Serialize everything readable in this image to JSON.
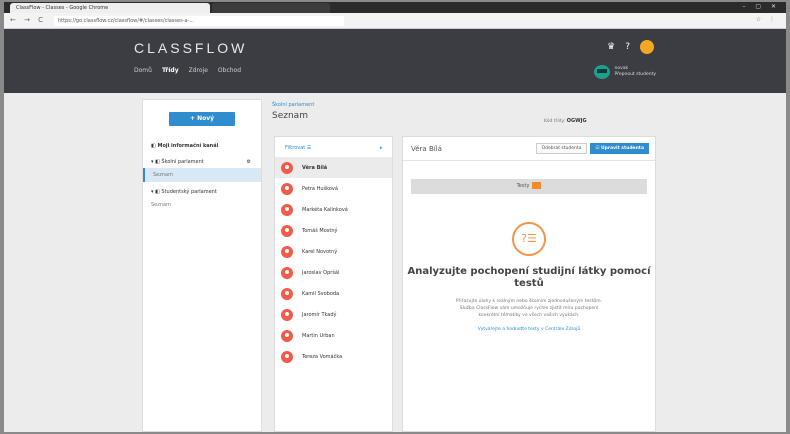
{
  "browser": {
    "tab_title": "ClassFlow - Classes - Google Chrome",
    "url": "https://go.classflow.cz/classflow/#/classes/classes-a-...",
    "nav_icons": "← → C",
    "ext_icons": "☆ ⋮"
  },
  "app": {
    "logo": "CLASSFLOW",
    "nav": [
      "Domů",
      "Třídy",
      "Zdroje",
      "Obchod"
    ],
    "active_nav": "Třídy",
    "user_name": "novak",
    "user_role": "Přepnout studenty"
  },
  "sidebar": {
    "new_button": "+ Nový",
    "section_title": "Moji informační kanál",
    "groups": [
      {
        "label": "Školní parlament",
        "sub": "Seznam"
      },
      {
        "label": "Studentský parlament",
        "sub": "Seznam"
      }
    ]
  },
  "main": {
    "breadcrumb": "Školní parlament",
    "title": "Seznam",
    "team_code_label": "Kód třídy:",
    "team_code": "OGWJG"
  },
  "list": {
    "filter_label": "Filtrovat ☰",
    "filter_icon": "⬧",
    "students": [
      "Věra Bílá",
      "Petra Hušková",
      "Markéta Kalinková",
      "Tomáš Mostný",
      "Karel Novotný",
      "Jaroslav Opršál",
      "Kamil Svoboda",
      "Jaromír Tkadý",
      "Martin Urban",
      "Tereza Vomáčka"
    ]
  },
  "detail": {
    "student_name": "Věra Bílá",
    "edit_button": "Odebrat studenta",
    "delete_button": "☑ Upravit studenta",
    "tests_label": "Testy",
    "icon_symbol": "?☰",
    "empty_title": "Analyzujte pochopení studijní látky pomocí testů",
    "empty_body": "Přiřazujte úlohy k reálným nebo školním zjednodušeným testům. Služba ClassFlow vám umožňuje rychle zjistit míru pochopení konkrétní tématiky ve všech vašich výukách.",
    "empty_link": "Vytvářejte a hodnoťte testy v Centrále Zdrojů"
  }
}
